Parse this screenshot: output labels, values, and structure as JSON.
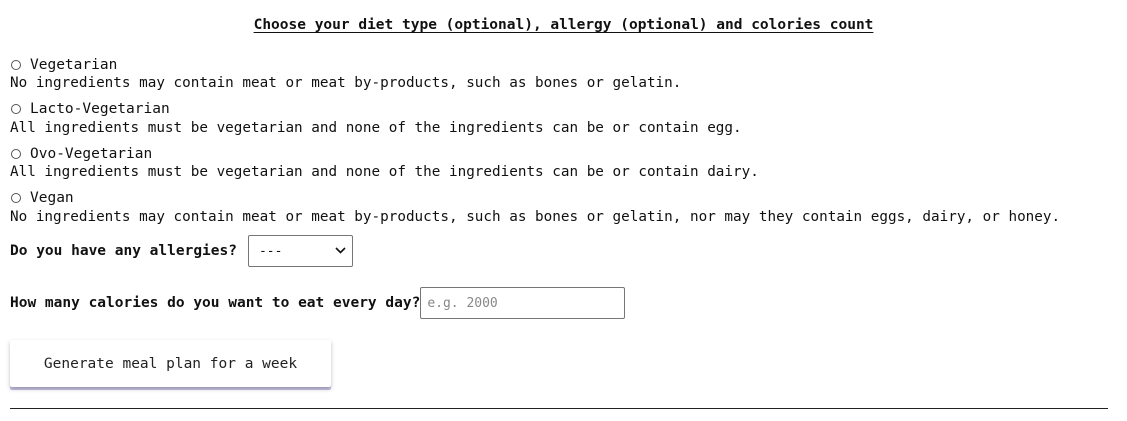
{
  "page": {
    "title": "Choose your diet type (optional), allergy (optional) and colories count"
  },
  "diet_options": [
    {
      "label": "Vegetarian",
      "description": "No ingredients may contain meat or meat by-products, such as bones or gelatin."
    },
    {
      "label": "Lacto-Vegetarian",
      "description": "All ingredients must be vegetarian and none of the ingredients can be or contain egg."
    },
    {
      "label": "Ovo-Vegetarian",
      "description": "All ingredients must be vegetarian and none of the ingredients can be or contain dairy."
    },
    {
      "label": "Vegan",
      "description": "No ingredients may contain meat or meat by-products, such as bones or gelatin, nor may they contain eggs, dairy, or honey."
    }
  ],
  "allergy": {
    "label": "Do you have any allergies?",
    "selected": "---"
  },
  "calories": {
    "label": "How many calories do you want to eat every day?",
    "value": "",
    "placeholder": "e.g. 2000"
  },
  "submit": {
    "label": "Generate meal plan for a week"
  },
  "colors": {
    "button_shadow": "#c9c4e6",
    "border": "#767676"
  },
  "icons": {
    "select_indicator": "chevron-down-icon"
  }
}
